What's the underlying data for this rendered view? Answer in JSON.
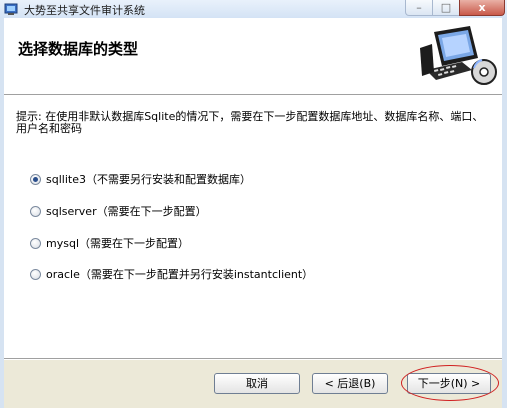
{
  "window": {
    "title": "大势至共享文件审计系统",
    "buttons": {
      "minimize": "–",
      "maximize": "□",
      "close": "x"
    }
  },
  "header": {
    "title": "选择数据库的类型",
    "image_icon": "computer-with-disc-icon"
  },
  "content": {
    "hint": "提示: 在使用非默认数据库Sqlite的情况下，需要在下一步配置数据库地址、数据库名称、端口、用户名和密码",
    "options": [
      {
        "label": "sqllite3（不需要另行安装和配置数据库）",
        "checked": true
      },
      {
        "label": "sqlserver（需要在下一步配置）",
        "checked": false
      },
      {
        "label": "mysql（需要在下一步配置）",
        "checked": false
      },
      {
        "label": "oracle（需要在下一步配置并另行安装instantclient）",
        "checked": false
      }
    ]
  },
  "footer": {
    "cancel_label": "取消",
    "back_label": "< 后退(B)",
    "next_label": "下一步(N) >"
  },
  "colors": {
    "footer_bg": "#ece9d8",
    "annotation": "#d02020",
    "radio_selected": "#2a4e8c"
  }
}
